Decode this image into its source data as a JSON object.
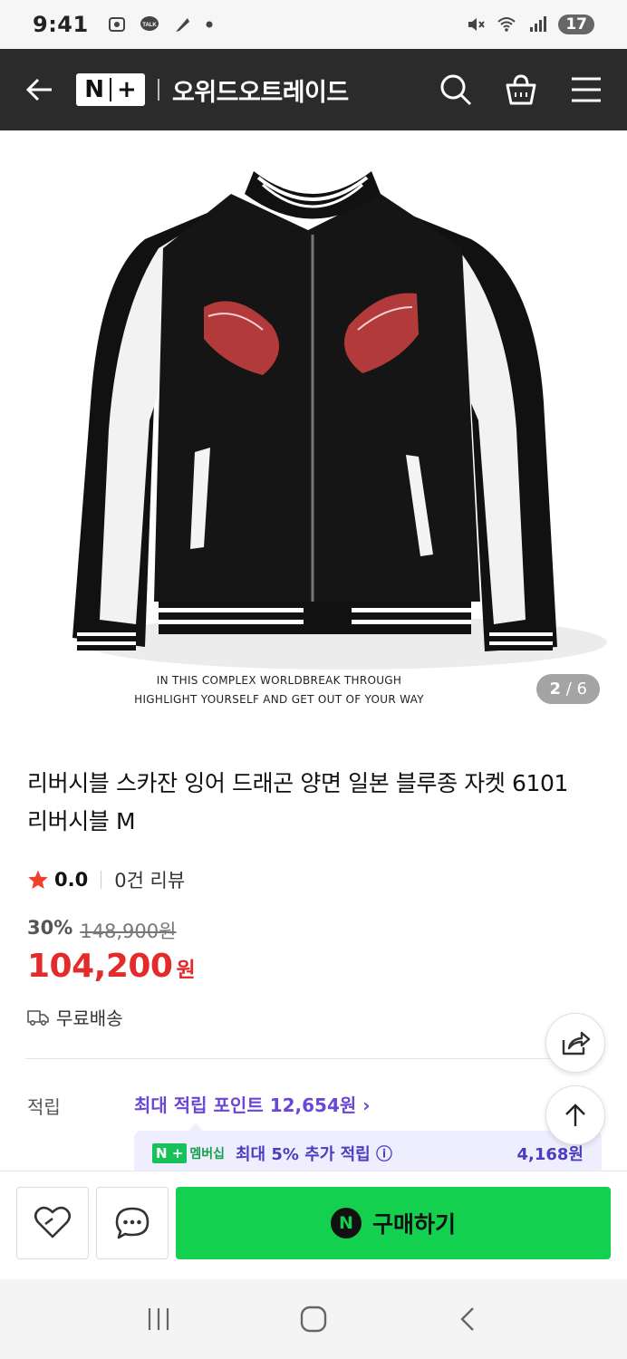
{
  "status_bar": {
    "time": "9:41",
    "battery": "17",
    "icons": [
      "screenshot-icon",
      "talk-icon",
      "feather-icon",
      "dot-icon",
      "mute-icon",
      "wifi-icon",
      "signal-icon"
    ]
  },
  "header": {
    "brand_logo": "N+",
    "store_name": "오위드오트레이드",
    "icons": [
      "back-arrow-icon",
      "search-icon",
      "shopping-bag-icon",
      "menu-icon"
    ]
  },
  "gallery": {
    "caption_line1": "IN THIS COMPLEX WORLDBREAK THROUGH",
    "caption_line2": "HIGHLIGHT YOURSELF AND GET OUT OF YOUR WAY",
    "current_page": "2",
    "page_separator": "/",
    "total_pages": "6"
  },
  "product": {
    "title": "리버시블 스카잔 잉어 드래곤 양면 일본 블루종 자켓 6101 리버시블 M",
    "rating": "0.0",
    "review_count": "0건 리뷰",
    "discount_rate": "30%",
    "original_price": "148,900원",
    "price": "104,200",
    "currency": "원",
    "shipping": "무료배송"
  },
  "points": {
    "label": "적립",
    "max_points_link": "최대 적립 포인트 12,654원 ›",
    "membership_badge_text": "멤버십",
    "membership_info": "최대 5% 추가 적립 ⓘ",
    "membership_amount": "4,168원"
  },
  "bottom_bar": {
    "buy_label": "구매하기",
    "buy_badge": "N"
  },
  "colors": {
    "header_bg": "#2b2b2b",
    "price_red": "#e32b2b",
    "point_purple": "#6b47d6",
    "buy_green": "#14d04f",
    "naver_green": "#18c25a"
  }
}
